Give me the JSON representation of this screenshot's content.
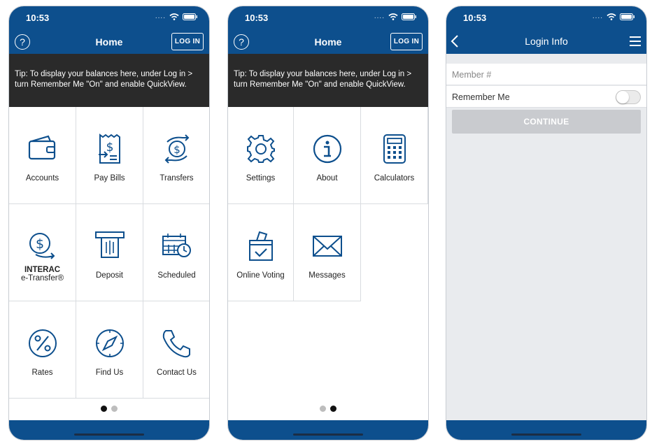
{
  "accent_color": "#0d4f8d",
  "status_time": "10:53",
  "home": {
    "title": "Home",
    "help_icon": "question-circle-icon",
    "login_label": "LOG IN",
    "tip": "Tip: To display your balances here, under Log in > turn Remember Me \"On\" and enable QuickView."
  },
  "screen1_tiles": [
    {
      "label": "Accounts",
      "icon": "wallet-icon"
    },
    {
      "label": "Pay Bills",
      "icon": "receipt-dollar-icon"
    },
    {
      "label": "Transfers",
      "icon": "transfer-dollar-icon"
    },
    {
      "label": "INTERAC",
      "label2": "e-Transfer®",
      "icon": "interac-dollar-icon"
    },
    {
      "label": "Deposit",
      "icon": "atm-deposit-icon"
    },
    {
      "label": "Scheduled",
      "icon": "calendar-clock-icon"
    },
    {
      "label": "Rates",
      "icon": "percent-icon"
    },
    {
      "label": "Find Us",
      "icon": "compass-icon"
    },
    {
      "label": "Contact Us",
      "icon": "phone-icon"
    }
  ],
  "screen2_tiles": [
    {
      "label": "Settings",
      "icon": "gear-icon"
    },
    {
      "label": "About",
      "icon": "info-icon"
    },
    {
      "label": "Calculators",
      "icon": "calculator-icon"
    },
    {
      "label": "Online Voting",
      "icon": "ballot-box-icon"
    },
    {
      "label": "Messages",
      "icon": "envelope-icon"
    }
  ],
  "screen1_page": {
    "current": 1,
    "total": 2
  },
  "screen2_page": {
    "current": 2,
    "total": 2
  },
  "login": {
    "title": "Login Info",
    "member_placeholder": "Member #",
    "remember_label": "Remember Me",
    "remember_on": false,
    "continue_label": "CONTINUE"
  }
}
